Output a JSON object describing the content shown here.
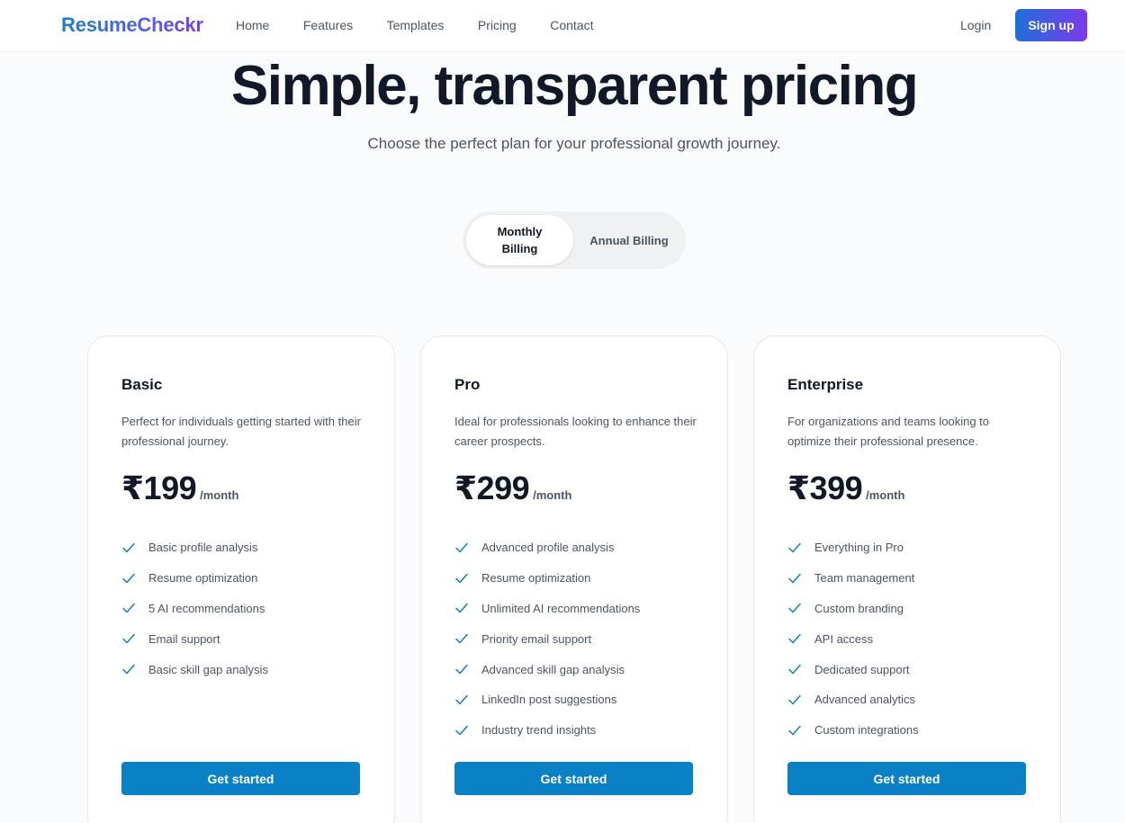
{
  "app": {
    "brand": "ResumeCheckr",
    "colors": {
      "brand_start": "#1a7fc4",
      "brand_end": "#7c3aed",
      "cta": "#0a80c6",
      "check": "#0a80c6"
    }
  },
  "nav": {
    "links": [
      "Home",
      "Features",
      "Templates",
      "Pricing",
      "Contact"
    ],
    "login": "Login",
    "signup": "Sign up"
  },
  "hero": {
    "title": "Simple, transparent pricing",
    "subtitle": "Choose the perfect plan for your professional growth journey."
  },
  "billing": {
    "monthly": "Monthly Billing",
    "annual": "Annual Billing",
    "selected": "Monthly Billing"
  },
  "plans": [
    {
      "name": "Basic",
      "description": "Perfect for individuals getting started with their professional journey.",
      "price": "₹199",
      "period": "/month",
      "features": [
        "Basic profile analysis",
        "Resume optimization",
        "5 AI recommendations",
        "Email support",
        "Basic skill gap analysis"
      ],
      "cta": "Get started"
    },
    {
      "name": "Pro",
      "description": "Ideal for professionals looking to enhance their career prospects.",
      "price": "₹299",
      "period": "/month",
      "features": [
        "Advanced profile analysis",
        "Resume optimization",
        "Unlimited AI recommendations",
        "Priority email support",
        "Advanced skill gap analysis",
        "LinkedIn post suggestions",
        "Industry trend insights"
      ],
      "cta": "Get started"
    },
    {
      "name": "Enterprise",
      "description": "For organizations and teams looking to optimize their professional presence.",
      "price": "₹399",
      "period": "/month",
      "features": [
        "Everything in Pro",
        "Team management",
        "Custom branding",
        "API access",
        "Dedicated support",
        "Advanced analytics",
        "Custom integrations"
      ],
      "cta": "Get started"
    }
  ],
  "icons": {
    "feature_check": "check-icon"
  }
}
